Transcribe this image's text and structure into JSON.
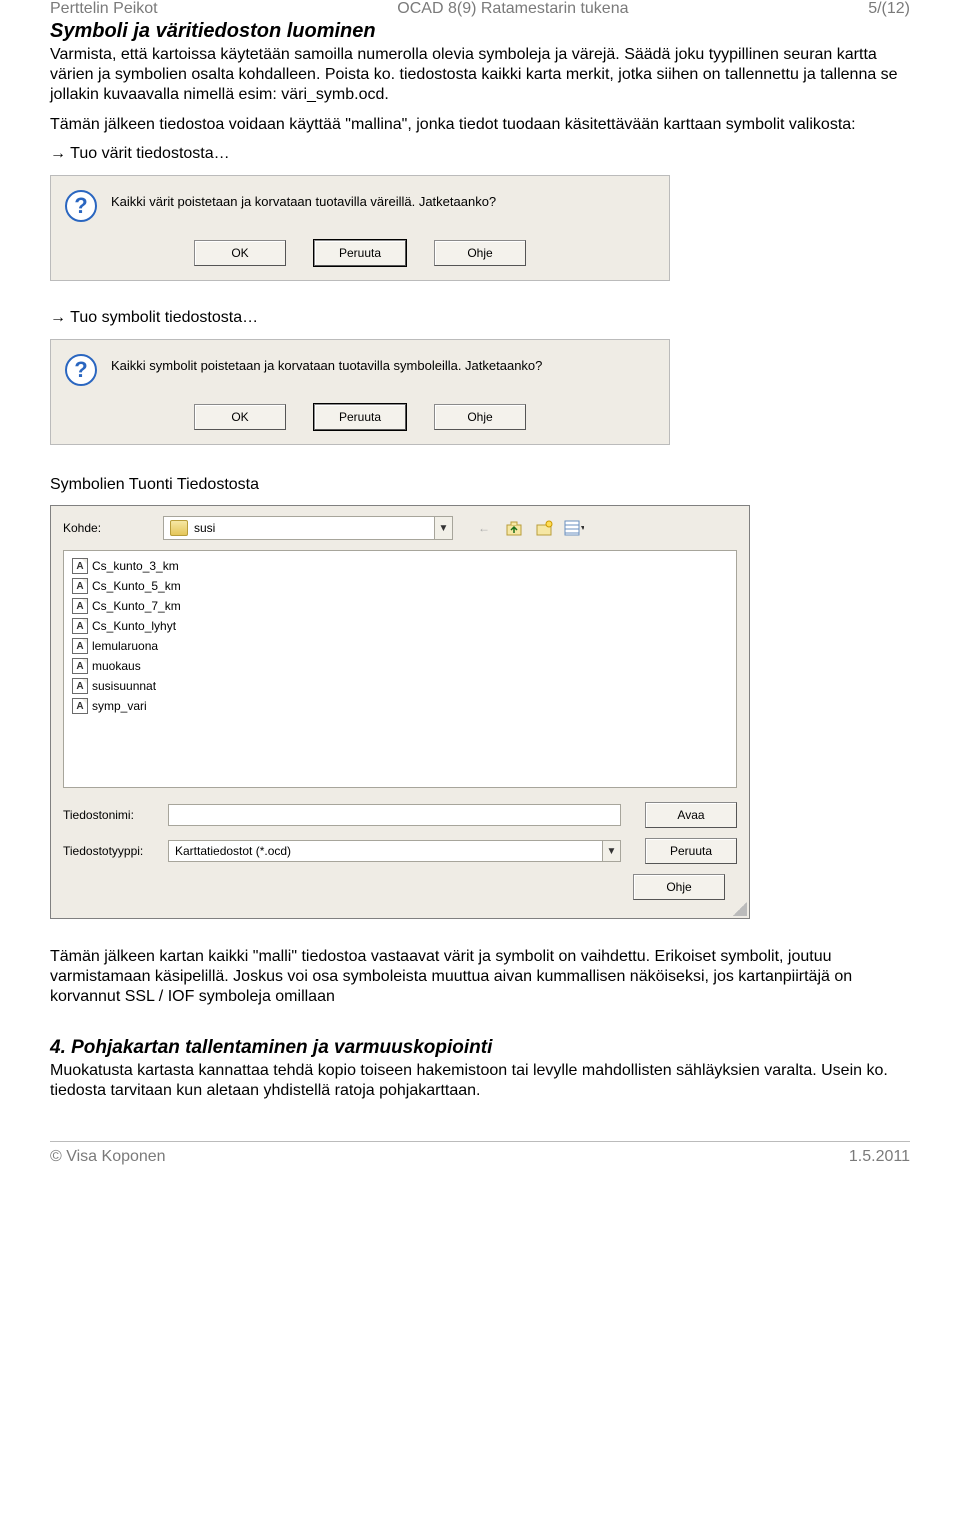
{
  "header": {
    "left": "Perttelin Peikot",
    "center": "OCAD 8(9) Ratamestarin tukena",
    "right": "5/(12)"
  },
  "section1": {
    "title": "Symboli ja väritiedoston luominen",
    "p1": "Varmista, että kartoissa käytetään samoilla numerolla olevia symboleja ja värejä. Säädä joku tyypillinen seuran kartta värien ja symbolien osalta kohdalleen. Poista ko. tiedostosta kaikki karta merkit, jotka siihen on tallennettu ja tallenna se jollakin kuvaavalla nimellä esim: väri_symb.ocd.",
    "p2": "Tämän jälkeen tiedostoa voidaan käyttää \"mallina\", jonka tiedot tuodaan käsitettävään karttaan symbolit valikosta:",
    "arrow1": "→ Tuo värit tiedostosta…",
    "arrow2": "→ Tuo symbolit tiedostosta…"
  },
  "dialog1": {
    "message": "Kaikki värit poistetaan ja korvataan tuotavilla väreillä. Jatketaanko?",
    "ok": "OK",
    "cancel": "Peruuta",
    "help": "Ohje"
  },
  "dialog2": {
    "message": "Kaikki symbolit poistetaan ja korvataan tuotavilla symboleilla. Jatketaanko?",
    "ok": "OK",
    "cancel": "Peruuta",
    "help": "Ohje"
  },
  "section2": {
    "title": "Symbolien Tuonti Tiedostosta"
  },
  "filedlg": {
    "kohde": "Kohde:",
    "folder": "susi",
    "files": [
      "Cs_kunto_3_km",
      "Cs_Kunto_5_km",
      "Cs_Kunto_7_km",
      "Cs_Kunto_lyhyt",
      "lemularuona",
      "muokaus",
      "susisuunnat",
      "symp_vari"
    ],
    "fname_label": "Tiedostonimi:",
    "ftype_label": "Tiedostotyyppi:",
    "ftype_value": "Karttatiedostot (*.ocd)",
    "open": "Avaa",
    "cancel": "Peruuta",
    "help": "Ohje"
  },
  "section3": {
    "p1": "Tämän jälkeen kartan kaikki \"malli\" tiedostoa vastaavat värit ja symbolit on vaihdettu. Erikoiset symbolit, joutuu varmistamaan käsipelillä. Joskus voi osa symboleista muuttua aivan kummallisen näköiseksi, jos kartanpiirtäjä on korvannut SSL / IOF symboleja omillaan"
  },
  "section4": {
    "title": "4. Pohjakartan tallentaminen ja varmuuskopiointi",
    "p1": "Muokatusta kartasta kannattaa tehdä kopio toiseen hakemistoon tai levylle mahdollisten sähläyksien varalta. Usein ko. tiedosta tarvitaan kun aletaan yhdistellä ratoja pohjakarttaan."
  },
  "footer": {
    "left": "© Visa Koponen",
    "right": "1.5.2011"
  }
}
